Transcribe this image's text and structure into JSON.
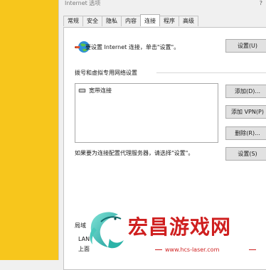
{
  "window": {
    "title": "Internet 选项",
    "help": "?"
  },
  "tabs": [
    "常规",
    "安全",
    "隐私",
    "内容",
    "连接",
    "程序",
    "高级"
  ],
  "active_tab": "连接",
  "connection_setup": {
    "text": "要设置 Internet 连接，单击\"设置\"。",
    "button": "设置(U)"
  },
  "dialup_vpn": {
    "section_label": "拨号和虚拟专用网络设置",
    "items": [
      {
        "label": "宽带连接"
      }
    ],
    "add_button": "添加(D)...",
    "add_vpn_button": "添加 VPN(P)",
    "remove_button": "删除(R)...",
    "proxy_text": "如果要为连接配置代理服务器，请选择\"设置\"。",
    "settings_button": "设置(S)"
  },
  "lan": {
    "label": "局域",
    "line1": "LAN",
    "line2": "上面"
  },
  "watermark": {
    "title": "宏昌游戏网",
    "url": "www.hcs-laser.com",
    "color": "#cf1f1f"
  },
  "colors": {
    "sidebar_yellow": "#f7c61c"
  }
}
